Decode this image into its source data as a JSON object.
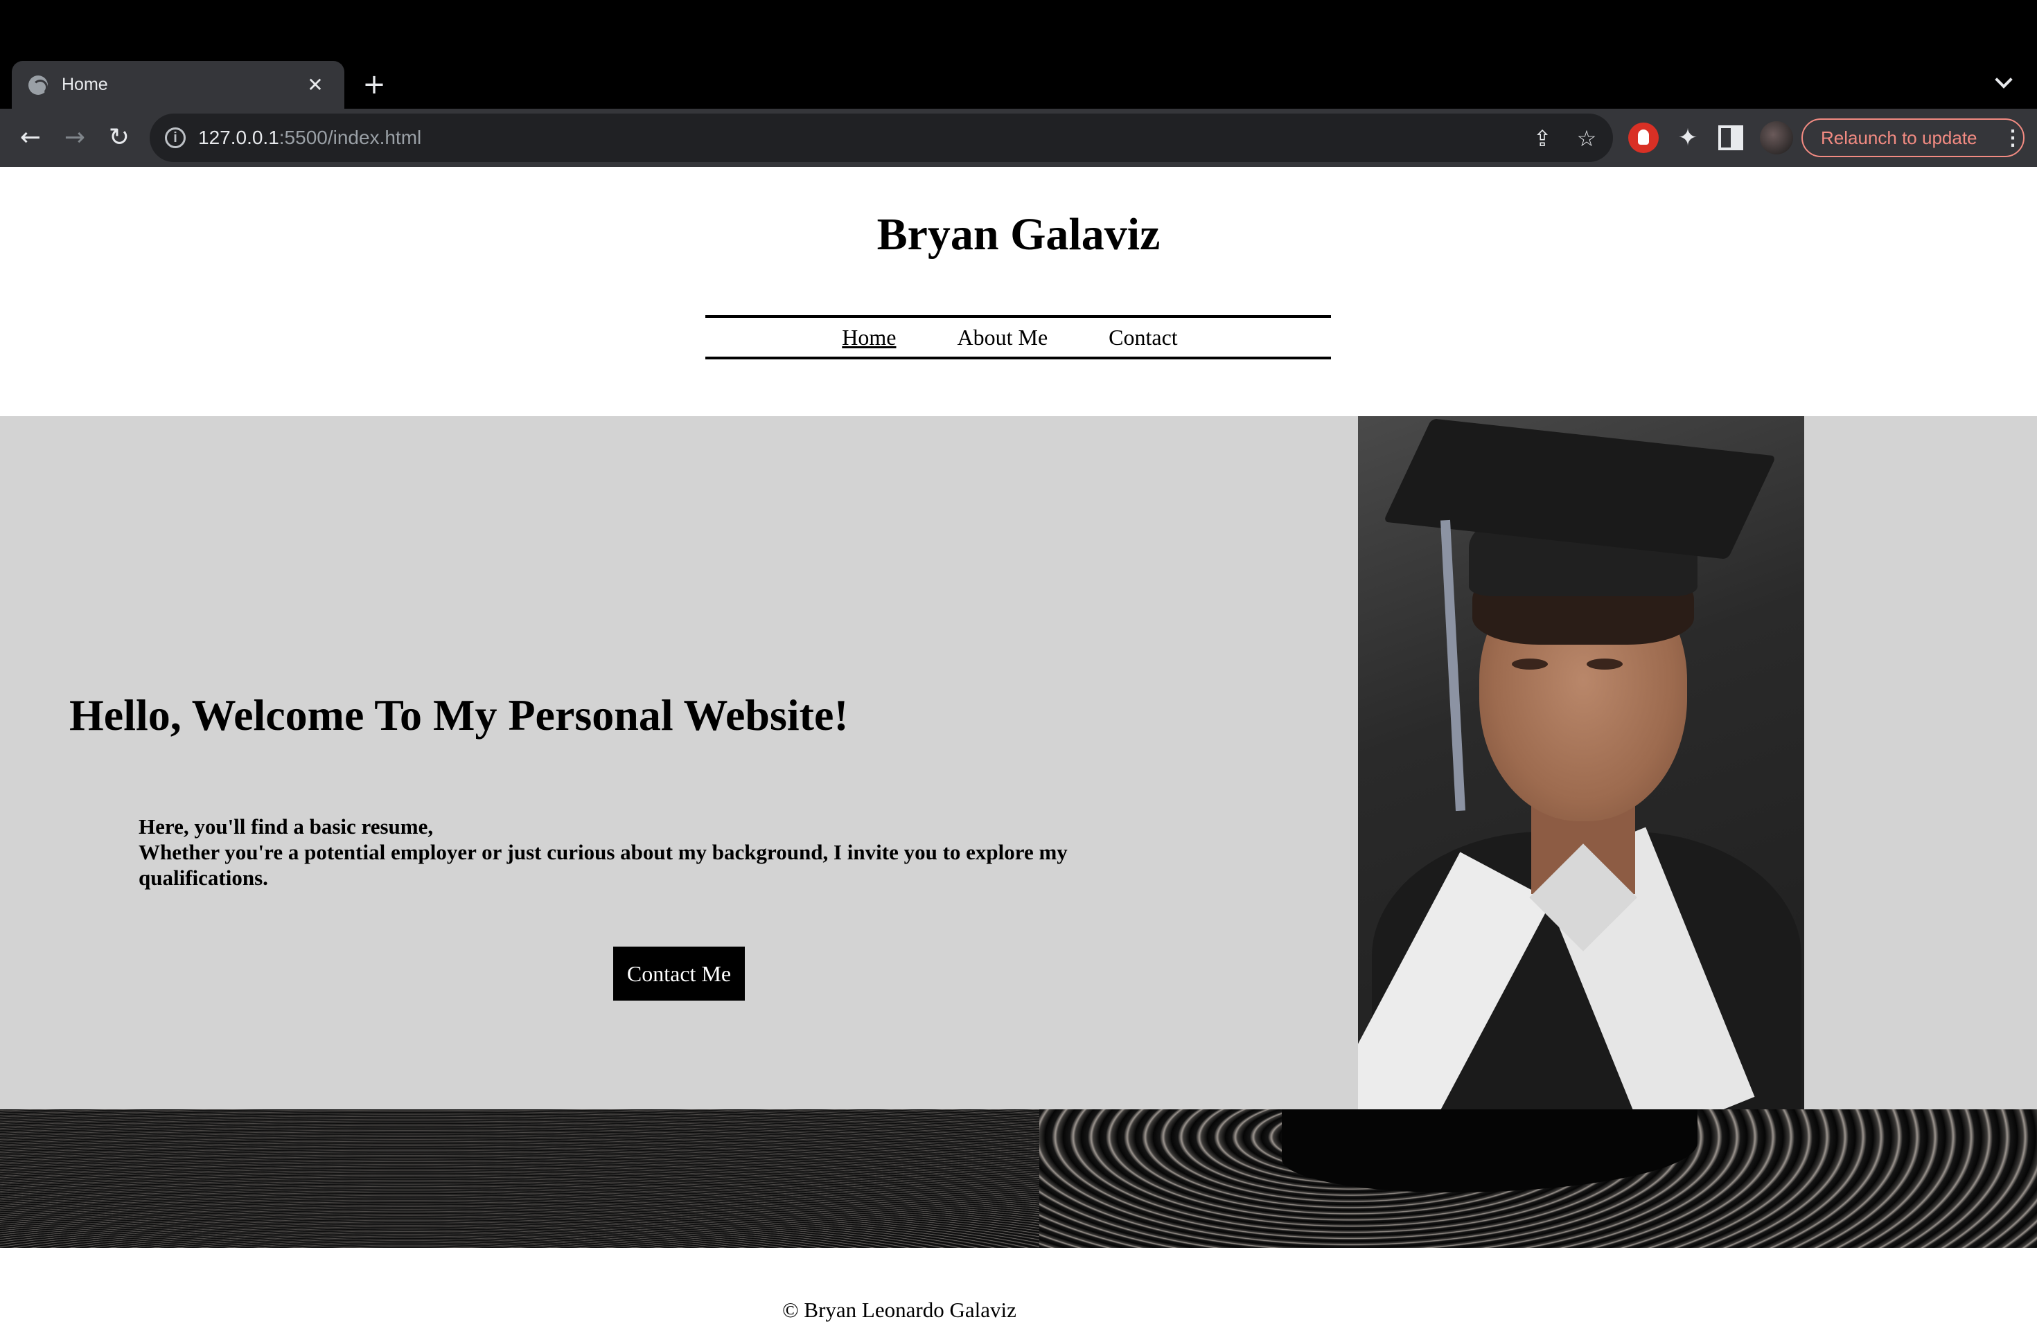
{
  "browser": {
    "tab_title": "Home",
    "tab_close": "✕",
    "new_tab": "+",
    "url_host": "127.0.0.1",
    "url_rest": ":5500/index.html",
    "relaunch_label": "Relaunch to update",
    "menu_dots": "⋮",
    "icons": [
      "back-icon",
      "forward-icon",
      "reload-icon",
      "info-icon",
      "share-icon",
      "bookmark-star-icon",
      "extension-icon",
      "puzzle-icon",
      "side-panel-icon",
      "profile-avatar"
    ]
  },
  "site": {
    "title": "Bryan Galaviz",
    "nav": [
      {
        "label": "Home",
        "active": true
      },
      {
        "label": "About Me",
        "active": false
      },
      {
        "label": "Contact",
        "active": false
      }
    ]
  },
  "hero": {
    "heading": "Hello, Welcome To My Personal Website!",
    "line1": "Here, you'll find a basic resume,",
    "line2": "Whether you're a potential employer or just curious about my background, I invite you to explore my qualifications.",
    "button_label": "Contact Me",
    "background": "#d3d3d3"
  },
  "footer": {
    "copyright": "© Bryan Leonardo Galaviz"
  }
}
